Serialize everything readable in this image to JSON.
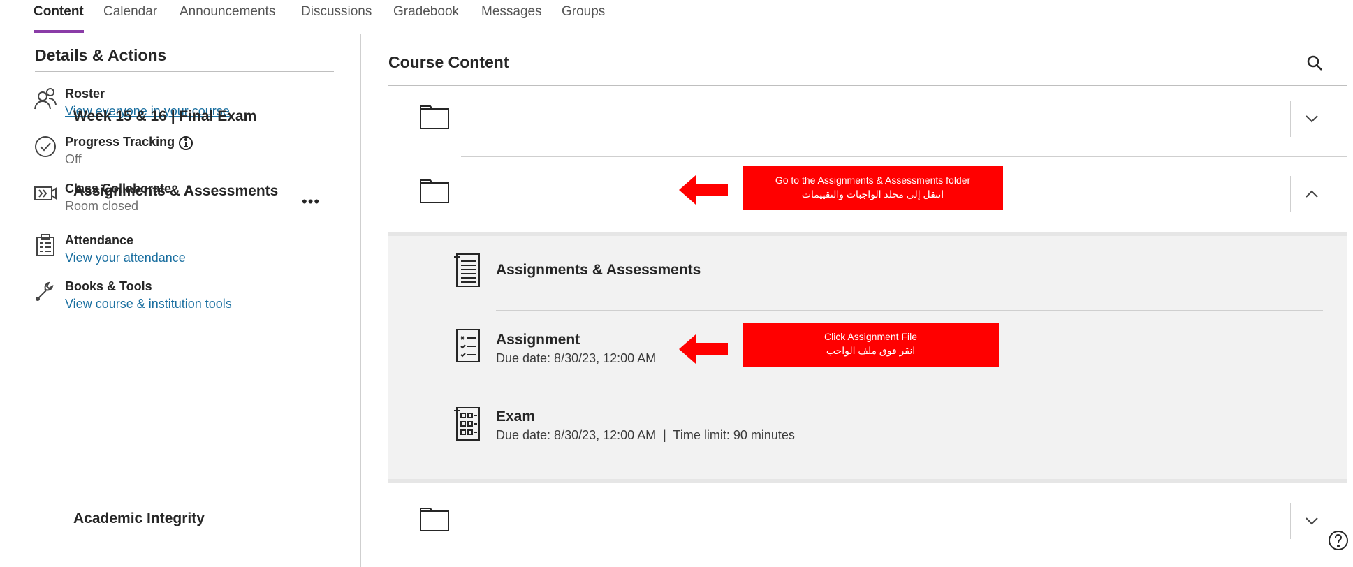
{
  "tabs": [
    "Content",
    "Calendar",
    "Announcements",
    "Discussions",
    "Gradebook",
    "Messages",
    "Groups"
  ],
  "details": {
    "title": "Details & Actions",
    "roster": {
      "name": "Roster",
      "link": "View everyone in your course"
    },
    "progress": {
      "name": "Progress Tracking",
      "status": "Off"
    },
    "collaborate": {
      "name": "Class Collaborate",
      "status": "Room closed"
    },
    "attendance": {
      "name": "Attendance",
      "link": "View your attendance"
    },
    "books": {
      "name": "Books & Tools",
      "link": "View course & institution tools"
    },
    "more_label": "•••"
  },
  "content": {
    "title": "Course Content",
    "folders": [
      {
        "name": "Week 15 & 16 | Final Exam",
        "expanded": false
      },
      {
        "name": "Assignments & Assessments",
        "expanded": true
      },
      {
        "name": "Academic Integrity",
        "expanded": false
      }
    ],
    "items": [
      {
        "name": "Assignments & Assessments",
        "sub": ""
      },
      {
        "name": "Assignment",
        "sub": "Due date: 8/30/23, 12:00 AM"
      },
      {
        "name": "Exam",
        "sub": "Due date: 8/30/23, 12:00 AM  |  Time limit: 90 minutes"
      }
    ]
  },
  "callouts": {
    "folder": {
      "en": "Go to the Assignments & Assessments folder",
      "ar": "انتقل إلى مجلد الواجبات والتقييمات"
    },
    "file": {
      "en": "Click Assignment File",
      "ar": "انقر فوق ملف الواجب"
    }
  },
  "colors": {
    "accent_tab": "#8a3ca7",
    "link": "#1a6fa0",
    "callout": "#ff0000"
  }
}
